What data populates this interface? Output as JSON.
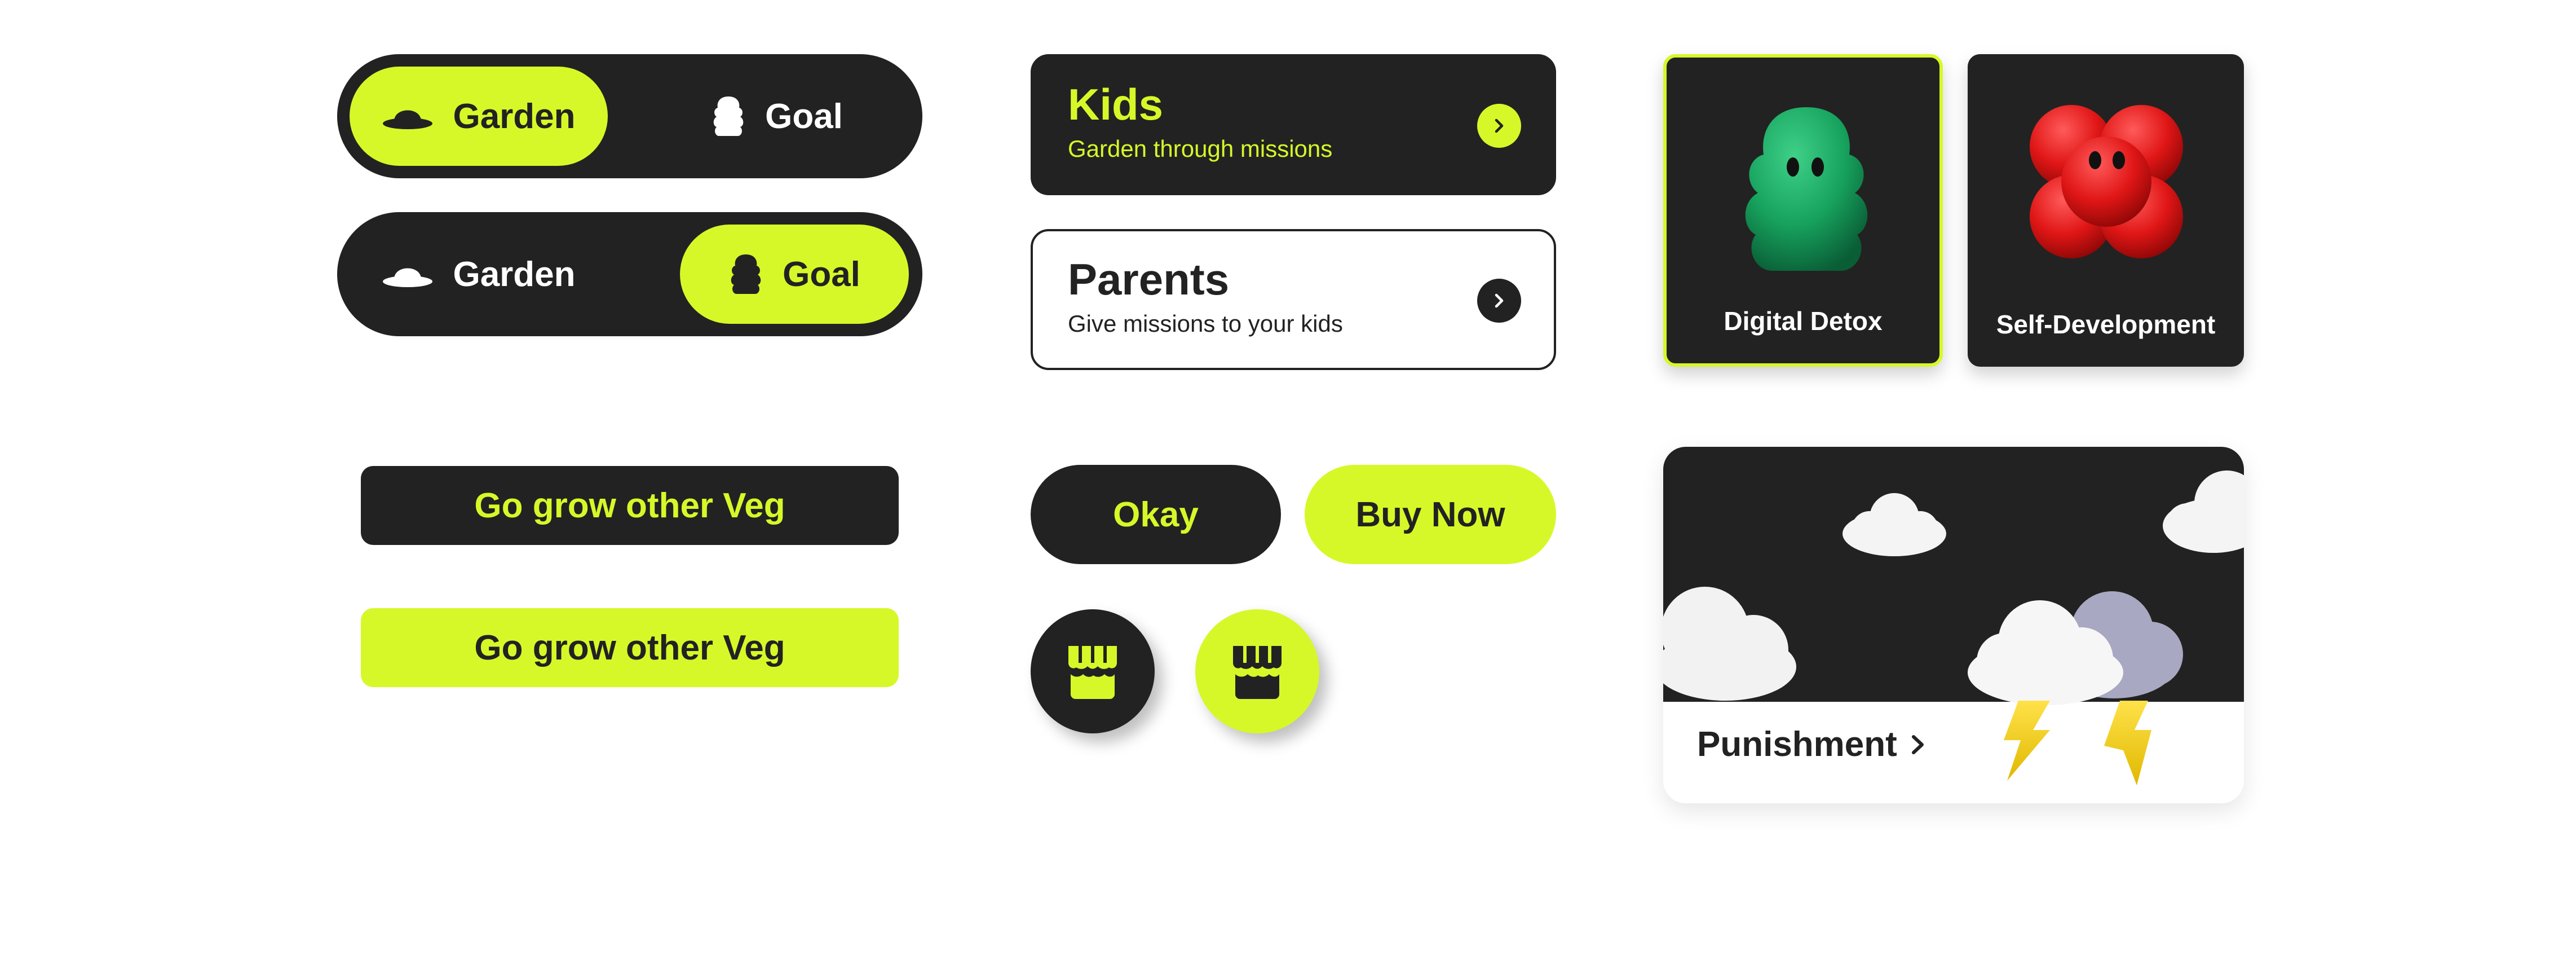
{
  "theme": {
    "accent": "#d7f828",
    "dark": "#222222",
    "light": "#ffffff"
  },
  "toggles": [
    {
      "left_label": "Garden",
      "right_label": "Goal",
      "selected": "left"
    },
    {
      "left_label": "Garden",
      "right_label": "Goal",
      "selected": "right"
    }
  ],
  "options": {
    "kids": {
      "title": "Kids",
      "subtitle": "Garden through missions"
    },
    "parents": {
      "title": "Parents",
      "subtitle": "Give missions to your kids"
    }
  },
  "categories": [
    {
      "label": "Digital Detox",
      "icon": "green-tree-creature-icon",
      "selected": true
    },
    {
      "label": "Self-Development",
      "icon": "red-flower-creature-icon",
      "selected": false
    }
  ],
  "buttons": {
    "grow_dark": "Go grow other Veg",
    "grow_lime": "Go grow other Veg",
    "okay": "Okay",
    "buy_now": "Buy Now"
  },
  "shop_icons": [
    "store-icon",
    "store-icon"
  ],
  "punishment": {
    "label": "Punishment",
    "icon": "thunder-cloud-icon"
  }
}
